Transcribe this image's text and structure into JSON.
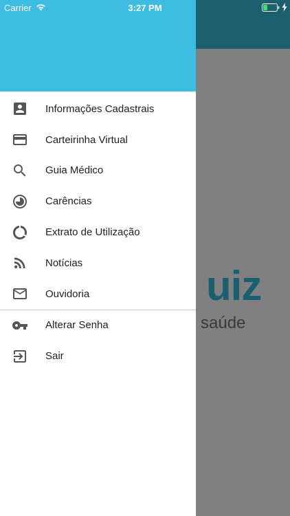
{
  "status_bar": {
    "carrier": "Carrier",
    "time": "3:27 PM",
    "wifi_icon": "wifi-icon",
    "battery_icon": "battery-icon",
    "charging_icon": "charging-bolt-icon"
  },
  "background_app": {
    "logo_main": "uiz",
    "logo_sub": "saúde"
  },
  "drawer": {
    "header_color": "#3dbde2",
    "items": [
      {
        "label": "Informações Cadastrais",
        "icon": "account-box-icon"
      },
      {
        "label": "Carteirinha Virtual",
        "icon": "credit-card-icon"
      },
      {
        "label": "Guia Médico",
        "icon": "search-icon"
      },
      {
        "label": "Carências",
        "icon": "pie-timer-icon"
      },
      {
        "label": "Extrato de Utilização",
        "icon": "donut-chart-icon"
      },
      {
        "label": "Notícias",
        "icon": "rss-feed-icon"
      },
      {
        "label": "Ouvidoria",
        "icon": "mail-icon"
      }
    ],
    "secondary_items": [
      {
        "label": "Alterar Senha",
        "icon": "key-icon"
      },
      {
        "label": "Sair",
        "icon": "exit-icon"
      }
    ]
  },
  "colors": {
    "drawer_header": "#3dbde2",
    "background_header": "#1c5f6e",
    "scrim": "#808080",
    "icon": "#555555",
    "text": "#212121"
  }
}
